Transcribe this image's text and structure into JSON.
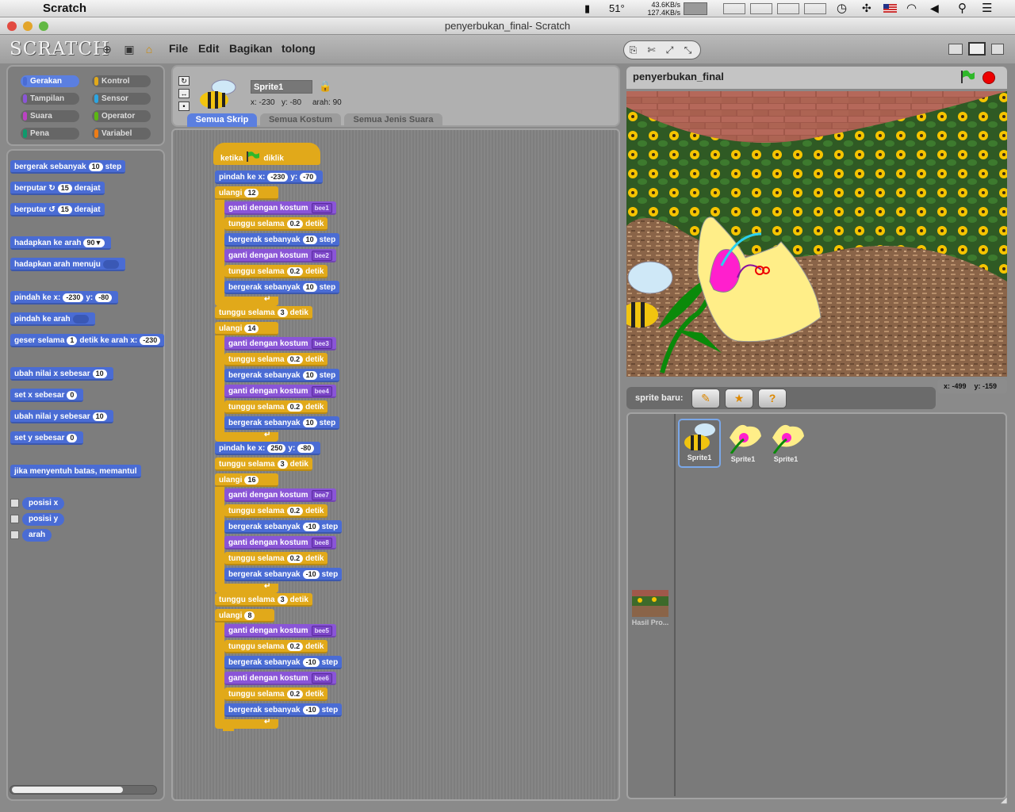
{
  "menubar": {
    "app_name": "Scratch",
    "temperature": "51°",
    "net_up": "43.6KB/s",
    "net_down": "127.4KB/s"
  },
  "window": {
    "title": "penyerbukan_final- Scratch"
  },
  "toolbar": {
    "logo": "SCRATCH",
    "menus": [
      "File",
      "Edit",
      "Bagikan",
      "tolong"
    ]
  },
  "categories": [
    {
      "label": "Gerakan",
      "color": "#4a6cd4"
    },
    {
      "label": "Kontrol",
      "color": "#e1a91a"
    },
    {
      "label": "Tampilan",
      "color": "#8a55d7"
    },
    {
      "label": "Sensor",
      "color": "#2ca5e2"
    },
    {
      "label": "Suara",
      "color": "#bb42c3"
    },
    {
      "label": "Operator",
      "color": "#5cb712"
    },
    {
      "label": "Pena",
      "color": "#0e9a6c"
    },
    {
      "label": "Variabel",
      "color": "#ee7d16"
    }
  ],
  "palette": {
    "move": {
      "pre": "bergerak sebanyak",
      "val": "10",
      "post": "step"
    },
    "turn_cw": {
      "pre": "berputar",
      "val": "15",
      "post": "derajat"
    },
    "turn_ccw": {
      "pre": "berputar",
      "val": "15",
      "post": "derajat"
    },
    "point_dir": {
      "pre": "hadapkan ke arah",
      "val": "90▼"
    },
    "point_to": {
      "pre": "hadapkan arah menuju"
    },
    "goto_xy": {
      "pre": "pindah ke x:",
      "x": "-230",
      "mid": "y:",
      "y": "-80"
    },
    "goto": {
      "pre": "pindah ke arah"
    },
    "glide": {
      "pre": "geser selama",
      "val": "1",
      "mid": "detik ke arah x:",
      "x": "-230"
    },
    "change_x": {
      "pre": "ubah nilai x sebesar",
      "val": "10"
    },
    "set_x": {
      "pre": "set x sebesar",
      "val": "0"
    },
    "change_y": {
      "pre": "ubah nilai y sebesar",
      "val": "10"
    },
    "set_y": {
      "pre": "set y sebesar",
      "val": "0"
    },
    "bounce": {
      "pre": "jika menyentuh batas, memantul"
    },
    "reporters": [
      "posisi x",
      "posisi y",
      "arah"
    ]
  },
  "sprite_info": {
    "name": "Sprite1",
    "x_label": "x: -230",
    "y_label": "y: -80",
    "dir_label": "arah: 90"
  },
  "tabs": [
    "Semua Skrip",
    "Semua Kostum",
    "Semua Jenis Suara"
  ],
  "script": {
    "hat": {
      "pre": "ketika",
      "post": "diklik"
    },
    "goto1": {
      "pre": "pindah ke x:",
      "x": "-230",
      "mid": "y:",
      "y": "-70"
    },
    "loops": [
      {
        "count": "12",
        "rows": [
          [
            "lk",
            "ganti dengan kostum",
            "bee1"
          ],
          [
            "ct",
            "tunggu selama",
            "0.2",
            "detik"
          ],
          [
            "mo",
            "bergerak sebanyak",
            "10",
            "step"
          ],
          [
            "lk",
            "ganti dengan kostum",
            "bee2"
          ],
          [
            "ct",
            "tunggu selama",
            "0.2",
            "detik"
          ],
          [
            "mo",
            "bergerak sebanyak",
            "10",
            "step"
          ]
        ]
      },
      {
        "count": "14",
        "rows": [
          [
            "lk",
            "ganti dengan kostum",
            "bee3"
          ],
          [
            "ct",
            "tunggu selama",
            "0.2",
            "detik"
          ],
          [
            "mo",
            "bergerak sebanyak",
            "10",
            "step"
          ],
          [
            "lk",
            "ganti dengan kostum",
            "bee4"
          ],
          [
            "ct",
            "tunggu selama",
            "0.2",
            "detik"
          ],
          [
            "mo",
            "bergerak sebanyak",
            "10",
            "step"
          ]
        ]
      },
      {
        "count": "16",
        "rows": [
          [
            "lk",
            "ganti dengan kostum",
            "bee7"
          ],
          [
            "ct",
            "tunggu selama",
            "0.2",
            "detik"
          ],
          [
            "mo",
            "bergerak sebanyak",
            "-10",
            "step"
          ],
          [
            "lk",
            "ganti dengan kostum",
            "bee8"
          ],
          [
            "ct",
            "tunggu selama",
            "0.2",
            "detik"
          ],
          [
            "mo",
            "bergerak sebanyak",
            "-10",
            "step"
          ]
        ]
      },
      {
        "count": "8",
        "rows": [
          [
            "lk",
            "ganti dengan kostum",
            "bee5"
          ],
          [
            "ct",
            "tunggu selama",
            "0.2",
            "detik"
          ],
          [
            "mo",
            "bergerak sebanyak",
            "-10",
            "step"
          ],
          [
            "lk",
            "ganti dengan kostum",
            "bee6"
          ],
          [
            "ct",
            "tunggu selama",
            "0.2",
            "detik"
          ],
          [
            "mo",
            "bergerak sebanyak",
            "-10",
            "step"
          ]
        ]
      }
    ],
    "wait1": {
      "pre": "tunggu selama",
      "val": "3",
      "post": "detik"
    },
    "goto2": {
      "pre": "pindah ke x:",
      "x": "250",
      "mid": "y:",
      "y": "-80"
    },
    "wait2": {
      "pre": "tunggu selama",
      "val": "3",
      "post": "detik"
    },
    "wait3": {
      "pre": "tunggu selama",
      "val": "3",
      "post": "detik"
    },
    "repeat_label": "ulangi"
  },
  "stage": {
    "title": "penyerbukan_final",
    "mouse_x": "x: -499",
    "mouse_y": "y: -159"
  },
  "sprites": {
    "new_label": "sprite baru:",
    "items": [
      "Sprite1",
      "Sprite1",
      "Sprite1"
    ],
    "stage_label": "Hasil Pro..."
  }
}
